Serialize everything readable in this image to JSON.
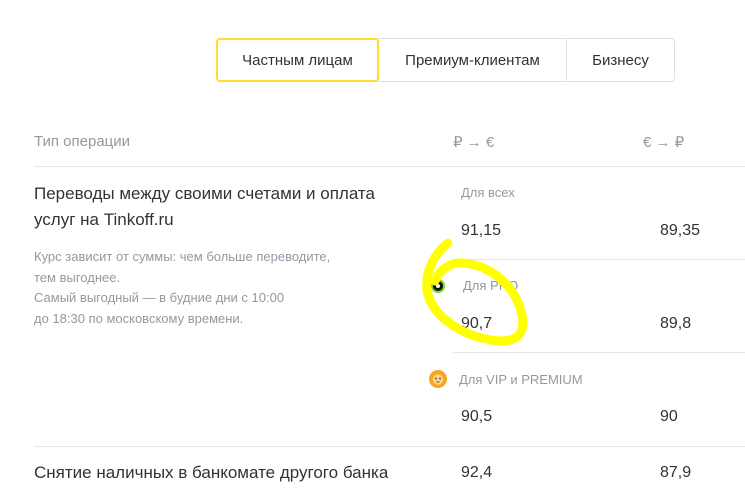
{
  "tabs": [
    {
      "label": "Частным лицам",
      "active": true
    },
    {
      "label": "Премиум-клиентам",
      "active": false
    },
    {
      "label": "Бизнесу",
      "active": false
    }
  ],
  "table": {
    "headers": {
      "operation": "Тип операции",
      "rub_eur": "₽ → €",
      "eur_rub": "€ → ₽"
    },
    "rows": [
      {
        "title_lines": [
          "Переводы между своими счетами и оплата",
          "услуг на Tinkoff.ru"
        ],
        "note_lines": [
          "Курс зависит от суммы: чем больше переводите,",
          "тем выгоднее.",
          "Самый выгодный — в будние дни с 10:00",
          "до 18:30 по московскому времени."
        ],
        "tiers": [
          {
            "label": "Для всех",
            "rub_eur": "91,15",
            "eur_rub": "89,35"
          },
          {
            "label": "Для PRO",
            "icon": "pro-badge-icon",
            "rub_eur": "90,7",
            "eur_rub": "89,8"
          },
          {
            "label": "Для VIP и PREMIUM",
            "icon": "lion-badge-icon",
            "rub_eur": "90,5",
            "eur_rub": "90"
          }
        ]
      },
      {
        "title_lines": [
          "Снятие наличных в банкомате другого банка"
        ],
        "rub_eur": "92,4",
        "eur_rub": "87,9"
      }
    ]
  },
  "colors": {
    "accent": "#ffdd2d",
    "scribble": "#ffff00",
    "muted_text": "#9299a2",
    "text": "#333333",
    "pro_green": "#7ed321",
    "vip_orange": "#f5a623"
  }
}
